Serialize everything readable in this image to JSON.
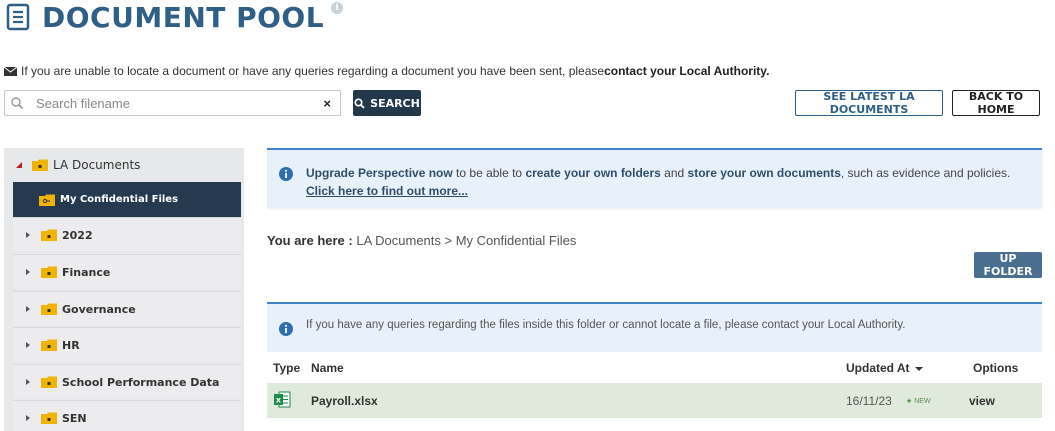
{
  "header": {
    "title": "DOCUMENT POOL",
    "info_mark": "i",
    "notice_text": "If you are unable to locate a document or have any queries regarding a document you have been sent, please ",
    "notice_bold": "contact your Local Authority."
  },
  "search": {
    "placeholder": "Search filename",
    "clear": "×",
    "button": "SEARCH"
  },
  "actions": {
    "latest": "SEE LATEST LA DOCUMENTS",
    "home": "BACK TO HOME"
  },
  "sidebar": {
    "root": "LA Documents",
    "active": "My Confidential Files",
    "items": [
      "2022",
      "Finance",
      "Governance",
      "HR",
      "School Performance Data",
      "SEN"
    ]
  },
  "banner": {
    "t1": "Upgrade Perspective now",
    "t2": " to be able to ",
    "t3": "create your own folders",
    "t4": " and ",
    "t5": "store your own documents",
    "t6": ", such as evidence and policies. ",
    "link": "Click here to find out more..."
  },
  "breadcrumb": {
    "label": "You are here :",
    "path": " LA Documents > My Confidential Files"
  },
  "up_folder": "UP FOLDER",
  "info2": "If you have any queries regarding the files inside this folder or cannot locate a file, please contact your Local Authority.",
  "table": {
    "columns": [
      "Type",
      "Name",
      "Updated At",
      "Options"
    ],
    "rows": [
      {
        "name": "Payroll.xlsx",
        "date": "16/11/23",
        "tag": "NEW",
        "option": "view"
      }
    ]
  },
  "colors": {
    "brand": "#2f5f86",
    "dark_button": "#24384c",
    "active_nav": "#263a4f",
    "info_blue": "#3c86c8",
    "row_highlight": "#dfeadc"
  }
}
